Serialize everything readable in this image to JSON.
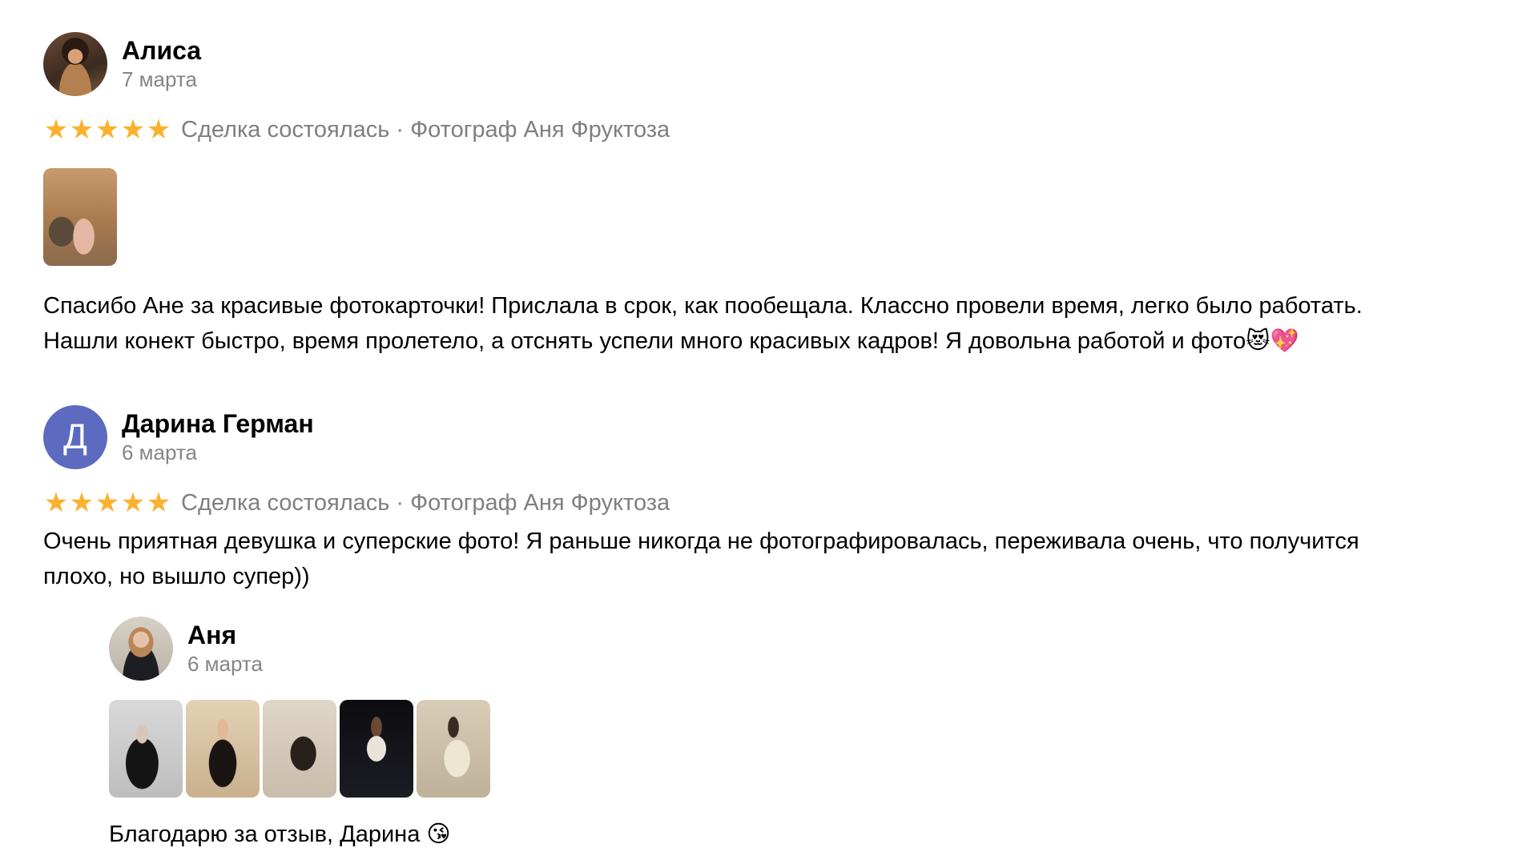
{
  "reviews": [
    {
      "name": "Алиса",
      "date": "7 марта",
      "rating": 5,
      "meta": "Сделка состоялась · Фотограф Аня Фруктоза",
      "text_line1": "Спасибо Ане за красивые фотокарточки! Прислала в срок, как пообещала. Классно провели время, легко было работать.",
      "text_line2": "Нашли конект быстро, время пролетело, а отснять успели много красивых кадров! Я довольна работой и фото😻💖"
    },
    {
      "name": "Дарина Герман",
      "avatar_letter": "Д",
      "date": "6 марта",
      "rating": 5,
      "meta": "Сделка состоялась · Фотограф Аня Фруктоза",
      "text_line1": "Очень приятная девушка и суперские фото! Я раньше никогда не фотографировалась, переживала очень, что получится",
      "text_line2": "плохо, но вышло супер))"
    }
  ],
  "reply": {
    "name": "Аня",
    "date": "6 марта",
    "text": "Благодарю за отзыв, Дарина 😘"
  },
  "star_glyph": "★",
  "colors": {
    "star": "#fbb12e",
    "meta": "#7f7f7f",
    "letter_avatar": "#5c6bc0"
  }
}
